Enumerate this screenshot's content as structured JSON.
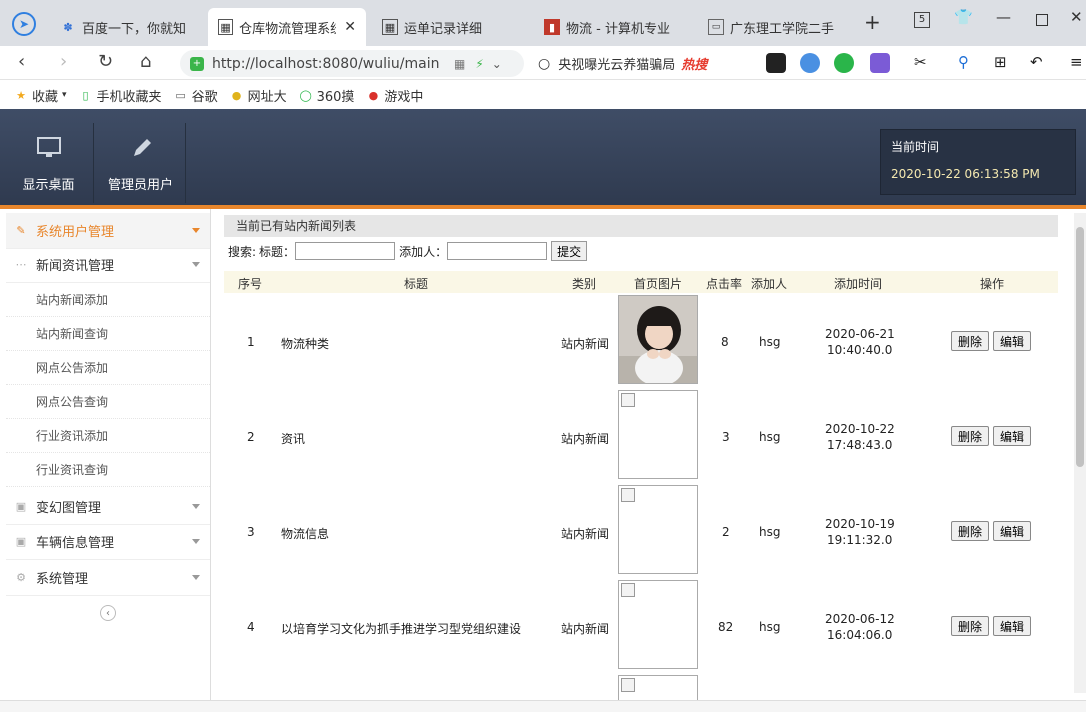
{
  "browser": {
    "tabs": [
      {
        "label": "百度一下，你就知",
        "icon": "paw-icon",
        "active": false
      },
      {
        "label": "仓库物流管理系统",
        "icon": "image-icon",
        "active": true
      },
      {
        "label": "运单记录详细",
        "icon": "image-icon",
        "active": false
      },
      {
        "label": "物流 - 计算机专业",
        "icon": "red-square-icon",
        "active": false
      },
      {
        "label": "广东理工学院二手",
        "icon": "page-icon",
        "active": false
      }
    ],
    "new_tab": "+",
    "url": "http://localhost:8080/wuliu/main",
    "search_text": "央视曝光云养猫骗局",
    "search_hot": "热搜",
    "bookmarks": [
      {
        "label": "收藏",
        "icon": "star-icon"
      },
      {
        "label": "手机收藏夹",
        "icon": "phone-icon"
      },
      {
        "label": "谷歌",
        "icon": "page-icon"
      },
      {
        "label": "网址大",
        "icon": "globe-icon"
      },
      {
        "label": "360摸",
        "icon": "ring-icon"
      },
      {
        "label": "游戏中",
        "icon": "game-icon"
      }
    ]
  },
  "header": {
    "buttons": [
      {
        "label": "显示桌面",
        "icon": "monitor-icon"
      },
      {
        "label": "管理员用户",
        "icon": "pencil-icon"
      }
    ],
    "time_label": "当前时间",
    "time_value": "2020-10-22 06:13:58 PM"
  },
  "sidebar": {
    "menus": [
      {
        "label": "系统用户管理",
        "active": true
      },
      {
        "label": "新闻资讯管理",
        "active": false
      }
    ],
    "submenu": [
      "站内新闻添加",
      "站内新闻查询",
      "网点公告添加",
      "网点公告查询",
      "行业资讯添加",
      "行业资讯查询"
    ],
    "menus2": [
      {
        "label": "变幻图管理"
      },
      {
        "label": "车辆信息管理"
      },
      {
        "label": "系统管理"
      }
    ],
    "collapse_icon": "‹"
  },
  "main": {
    "caption": "当前已有站内新闻列表",
    "search_label": "搜索:",
    "title_label": "标题：",
    "adder_label": "添加人：",
    "submit_label": "提交",
    "columns": [
      "序号",
      "标题",
      "类别",
      "首页图片",
      "点击率",
      "添加人",
      "添加时间",
      "操作"
    ],
    "rows": [
      {
        "no": "1",
        "title": "物流种类",
        "category": "站内新闻",
        "image": "photo-girl",
        "clicks": "8",
        "adder": "hsg",
        "date": "2020-06-21",
        "time": "10:40:40.0"
      },
      {
        "no": "2",
        "title": "资讯",
        "category": "站内新闻",
        "image": "broken",
        "clicks": "3",
        "adder": "hsg",
        "date": "2020-10-22",
        "time": "17:48:43.0"
      },
      {
        "no": "3",
        "title": "物流信息",
        "category": "站内新闻",
        "image": "broken",
        "clicks": "2",
        "adder": "hsg",
        "date": "2020-10-19",
        "time": "19:11:32.0"
      },
      {
        "no": "4",
        "title": "以培育学习文化为抓手推进学习型党组织建设",
        "category": "站内新闻",
        "image": "broken",
        "clicks": "82",
        "adder": "hsg",
        "date": "2020-06-12",
        "time": "16:04:06.0"
      }
    ],
    "delete_label": "删除",
    "edit_label": "编辑"
  }
}
